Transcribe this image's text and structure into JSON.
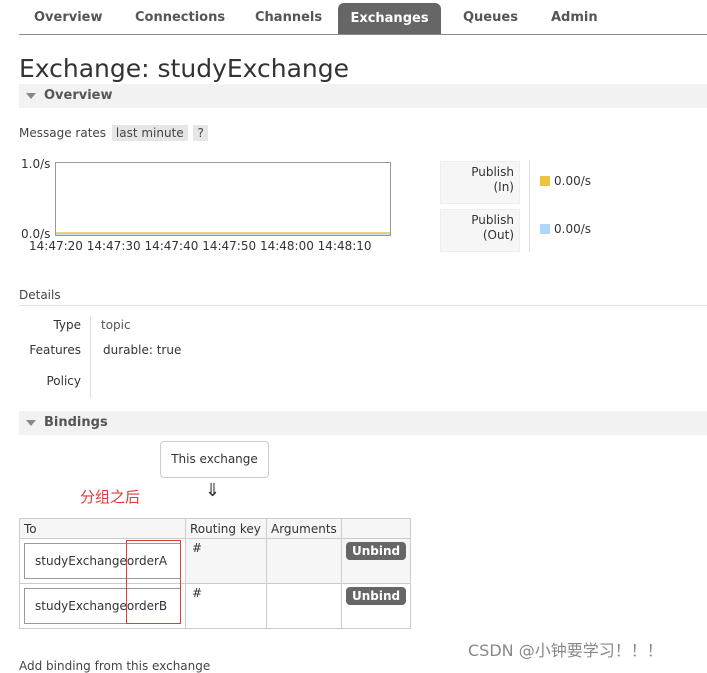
{
  "nav": {
    "tabs": [
      "Overview",
      "Connections",
      "Channels",
      "Exchanges",
      "Queues",
      "Admin"
    ],
    "active": "Exchanges"
  },
  "page": {
    "title": "Exchange: studyExchange"
  },
  "overview": {
    "header": "Overview",
    "rates_label": "Message rates",
    "rates_range": "last minute",
    "help": "?",
    "y_top": "1.0/s",
    "y_bottom": "0.0/s",
    "x_ticks": [
      "14:47:20",
      "14:47:30",
      "14:47:40",
      "14:47:50",
      "14:48:00",
      "14:48:10"
    ],
    "legend": [
      {
        "line1": "Publish",
        "line2": "(In)",
        "rate": "0.00/s",
        "color": "#edc240"
      },
      {
        "line1": "Publish",
        "line2": "(Out)",
        "rate": "0.00/s",
        "color": "#afd8f8"
      }
    ]
  },
  "details": {
    "title": "Details",
    "type_label": "Type",
    "type_value": "topic",
    "features_label": "Features",
    "features_key": "durable:",
    "features_value": "true",
    "policy_label": "Policy"
  },
  "bindings": {
    "header": "Bindings",
    "this_exchange": "This exchange",
    "arrow": "⇓",
    "annotation": "分组之后",
    "columns": [
      "To",
      "Routing key",
      "Arguments",
      ""
    ],
    "rows": [
      {
        "exchange": "studyExchange",
        "queue": "orderA",
        "routing_key": "#",
        "action": "Unbind"
      },
      {
        "exchange": "studyExchange",
        "queue": "orderB",
        "routing_key": "#",
        "action": "Unbind"
      }
    ]
  },
  "footer": {
    "add_binding": "Add binding from this exchange",
    "watermark": "CSDN @小钟要学习！！！"
  }
}
